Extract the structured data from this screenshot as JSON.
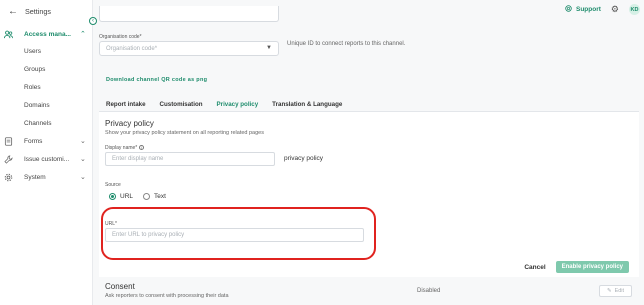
{
  "header": {
    "back_label": "Settings"
  },
  "sidebar": {
    "items": [
      {
        "label": "Access mana...",
        "icon": "people-icon"
      },
      {
        "label": "Users"
      },
      {
        "label": "Groups"
      },
      {
        "label": "Roles"
      },
      {
        "label": "Domains"
      },
      {
        "label": "Channels"
      },
      {
        "label": "Forms",
        "icon": "form-icon"
      },
      {
        "label": "Issue customi...",
        "icon": "wrench-icon"
      },
      {
        "label": "System",
        "icon": "gear-icon"
      }
    ]
  },
  "topbar": {
    "support_label": "Support",
    "avatar_initials": "KD"
  },
  "org": {
    "label": "Organisation code*",
    "placeholder": "Organisation code*",
    "helper": "Unique ID to connect reports to this channel.",
    "download_link": "Download channel QR code as png"
  },
  "tabs": [
    "Report intake",
    "Customisation",
    "Privacy policy",
    "Translation & Language"
  ],
  "active_tab": "Privacy policy",
  "privacy": {
    "title": "Privacy policy",
    "subtitle": "Show your privacy policy statement on all reporting related pages",
    "display_name_label": "Display name*",
    "display_name_placeholder": "Enter display name",
    "display_name_preview": "privacy policy",
    "source_label": "Source",
    "source_options": [
      "URL",
      "Text"
    ],
    "source_selected": "URL",
    "url_label": "URL*",
    "url_placeholder": "Enter URL to privacy policy"
  },
  "actions": {
    "cancel": "Cancel",
    "enable": "Enable privacy policy"
  },
  "consent": {
    "title": "Consent",
    "subtitle": "Ask reporters to consent with processing their data",
    "status": "Disabled",
    "edit": "Edit"
  },
  "colors": {
    "accent": "#1e8c6c",
    "highlight": "#e0231f",
    "primary_disabled": "#7fc9ad"
  }
}
